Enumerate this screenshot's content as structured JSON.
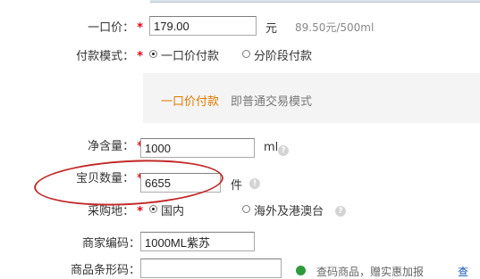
{
  "price": {
    "label": "一口价：",
    "star": "*",
    "value": "179.00",
    "unit": "元",
    "per_unit": "89.50元/500ml"
  },
  "payment_mode": {
    "label": "付款模式：",
    "star": "*",
    "options": [
      {
        "label": "一口价付款",
        "selected": true
      },
      {
        "label": "分阶段付款",
        "selected": false
      }
    ],
    "hint_strong": "一口价付款",
    "hint_text": "即普通交易模式"
  },
  "net_content": {
    "label": "净含量：",
    "star": "*",
    "value": "1000",
    "unit": "ml"
  },
  "quantity": {
    "label": "宝贝数量：",
    "star": "*",
    "value": "6655",
    "unit": "件"
  },
  "purchase_place": {
    "label": "采购地：",
    "star": "*",
    "options": [
      {
        "label": "国内",
        "selected": true
      },
      {
        "label": "海外及港澳台",
        "selected": false
      }
    ]
  },
  "merchant_code": {
    "label": "商家编码：",
    "value": "1000ML紫苏"
  },
  "barcode": {
    "label": "商品条形码：",
    "value": "",
    "note": "查码商品，赠实惠加报",
    "link": "查"
  },
  "colors": {
    "required_star": "#e60012",
    "hint_orange": "#e07a00",
    "annotation_red": "#c22a2a",
    "link_blue": "#1a55b8"
  }
}
